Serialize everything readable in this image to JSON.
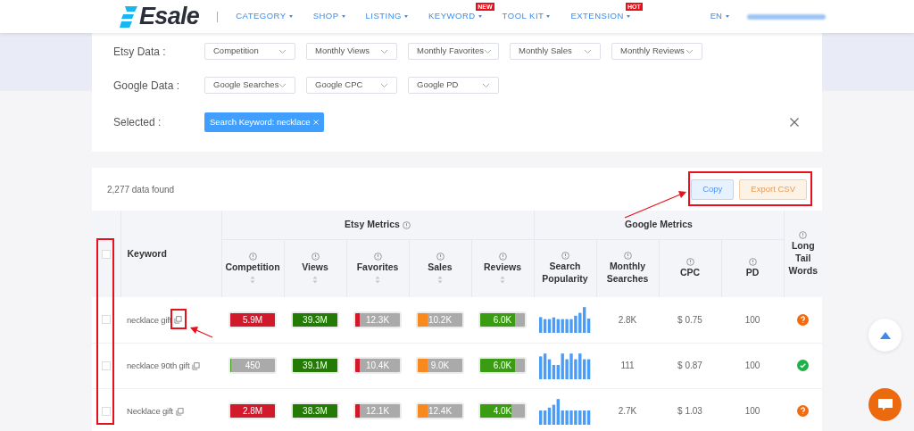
{
  "header": {
    "logo": "Esale",
    "nav": [
      {
        "label": "CATEGORY"
      },
      {
        "label": "SHOP"
      },
      {
        "label": "LISTING"
      },
      {
        "label": "KEYWORD",
        "badge": "NEW"
      },
      {
        "label": "TOOL KIT"
      },
      {
        "label": "EXTENSION",
        "badge": "HOT"
      }
    ],
    "language": "EN"
  },
  "filters": {
    "rows": [
      {
        "label": "Etsy Data :",
        "dropdowns": [
          "Competition",
          "Monthly Views",
          "Monthly Favorites",
          "Monthly Sales",
          "Monthly Reviews"
        ]
      },
      {
        "label": "Google Data :",
        "dropdowns": [
          "Google Searches",
          "Google CPC",
          "Google PD"
        ]
      }
    ],
    "selected": {
      "label": "Selected :",
      "tags": [
        "Search Keyword: necklace"
      ]
    }
  },
  "table": {
    "count": "2,277 data found",
    "buttons": [
      {
        "label": "Copy",
        "kind": "copy"
      },
      {
        "label": "Export CSV",
        "kind": "export"
      }
    ],
    "all_selected": false,
    "keyword_heading": "Keyword",
    "groups": [
      {
        "label": "Etsy Metrics",
        "columns": [
          {
            "label": "Competition",
            "sortable": true
          },
          {
            "label": "Views",
            "sortable": true
          },
          {
            "label": "Favorites",
            "sortable": true
          },
          {
            "label": "Sales",
            "sortable": true
          },
          {
            "label": "Reviews",
            "sortable": true
          }
        ]
      },
      {
        "label": "Google Metrics",
        "columns": [
          {
            "label": "Search Popularity",
            "sortable": false
          },
          {
            "label": "Monthly Searches",
            "sortable": false
          },
          {
            "label": "CPC",
            "sortable": false
          },
          {
            "label": "PD",
            "sortable": false
          }
        ]
      }
    ],
    "long_tail_heading": "Long Tail Words",
    "rows": [
      {
        "selected": false,
        "keyword": "necklace gift",
        "bars": [
          {
            "text": "5.9M",
            "level": 1,
            "color": "#d0192b"
          },
          {
            "text": "39.3M",
            "level": 1,
            "color": "#237a05"
          },
          {
            "text": "12.3K",
            "level": 0.1,
            "color": "#d0192b"
          },
          {
            "text": "10.2K",
            "level": 0.22,
            "color": "#f7891f"
          },
          {
            "text": "6.0K",
            "level": 0.78,
            "color": "#3a9c12"
          }
        ],
        "monthly": "2.8K",
        "cpc": "$ 0.75",
        "pd": "100",
        "long_tail": {
          "kind": "question"
        }
      },
      {
        "selected": false,
        "keyword": "necklace 90th gift",
        "bars": [
          {
            "text": "450",
            "level": 0.02,
            "color": "#3a9c12"
          },
          {
            "text": "39.1M",
            "level": 1,
            "color": "#237a05"
          },
          {
            "text": "10.4K",
            "level": 0.1,
            "color": "#d0192b"
          },
          {
            "text": "9.0K",
            "level": 0.22,
            "color": "#f7891f"
          },
          {
            "text": "6.0K",
            "level": 0.78,
            "color": "#3a9c12"
          }
        ],
        "monthly": "111",
        "cpc": "$ 0.87",
        "pd": "100",
        "long_tail": {
          "kind": "check"
        }
      },
      {
        "selected": false,
        "keyword": "Necklace gift",
        "bars": [
          {
            "text": "2.8M",
            "level": 1,
            "color": "#d0192b"
          },
          {
            "text": "38.3M",
            "level": 1,
            "color": "#237a05"
          },
          {
            "text": "12.1K",
            "level": 0.1,
            "color": "#d0192b"
          },
          {
            "text": "12.4K",
            "level": 0.22,
            "color": "#f7891f"
          },
          {
            "text": "4.0K",
            "level": 0.7,
            "color": "#3a9c12"
          }
        ],
        "monthly": "2.7K",
        "cpc": "$ 1.03",
        "pd": "100",
        "long_tail": {
          "kind": "question"
        }
      }
    ]
  }
}
